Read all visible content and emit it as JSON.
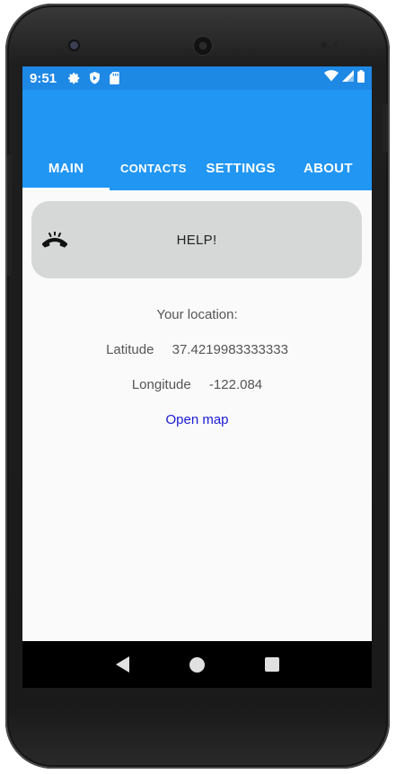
{
  "status": {
    "time": "9:51"
  },
  "tabs": [
    {
      "label": "MAIN",
      "active": true
    },
    {
      "label": "CONTACTS",
      "active": false
    },
    {
      "label": "SETTINGS",
      "active": false
    },
    {
      "label": "ABOUT",
      "active": false
    }
  ],
  "help": {
    "label": "HELP!",
    "icon": "phone-hangup-icon"
  },
  "location": {
    "title": "Your location:",
    "latitude_label": "Latitude",
    "latitude_value": "37.4219983333333",
    "longitude_label": "Longitude",
    "longitude_value": "-122.084",
    "open_map_label": "Open map"
  },
  "icons": {
    "status": [
      "gear-icon",
      "shield-icon",
      "sd-card-icon",
      "wifi-icon",
      "signal-icon",
      "battery-icon"
    ],
    "nav": [
      "back-icon",
      "home-icon",
      "recents-icon"
    ]
  },
  "colors": {
    "status_bar": "#1e88e5",
    "app_bar": "#2196f3",
    "help_button": "#d6d7d7",
    "link": "#1a1ad6",
    "background": "#fafafa"
  }
}
